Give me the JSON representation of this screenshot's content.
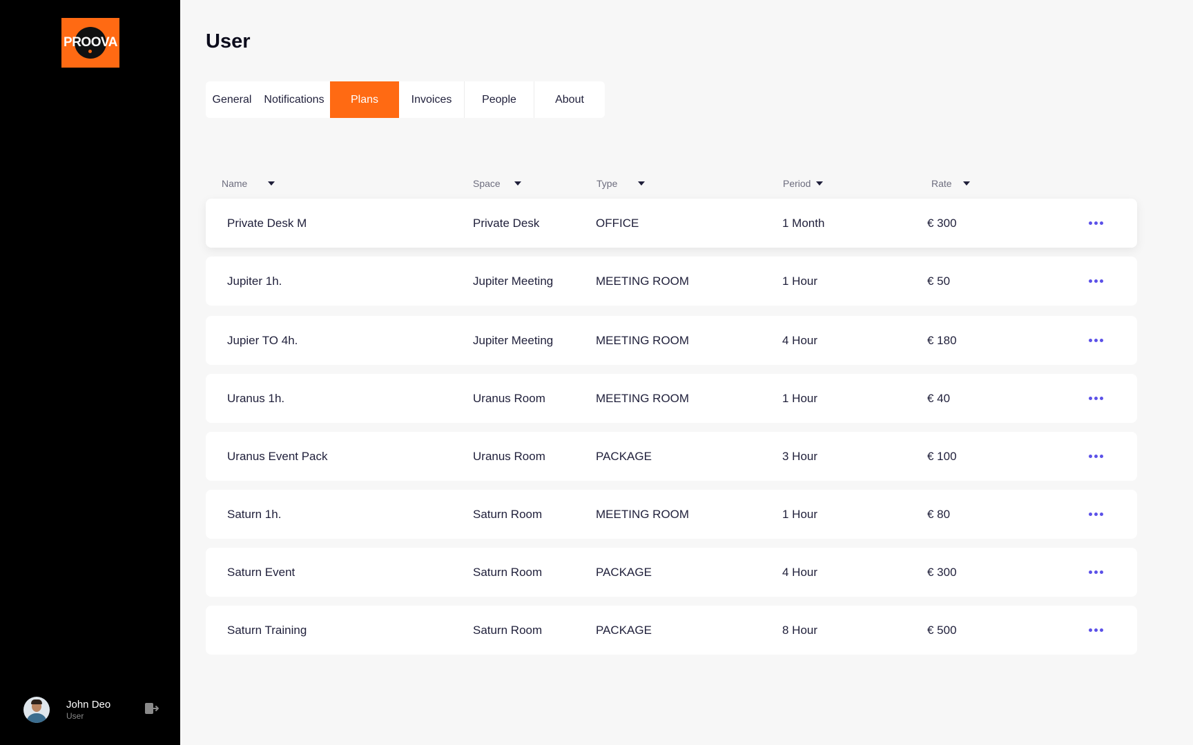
{
  "sidebar": {
    "logo_text": "PROOVA",
    "user": {
      "name": "John Deo",
      "role": "User"
    },
    "logout_icon": "logout-icon"
  },
  "page": {
    "title": "User"
  },
  "tabs": [
    {
      "label": "General",
      "active": false
    },
    {
      "label": "Notifications",
      "active": false
    },
    {
      "label": "Plans",
      "active": true
    },
    {
      "label": "Invoices",
      "active": false
    },
    {
      "label": "People",
      "active": false
    },
    {
      "label": "About",
      "active": false
    }
  ],
  "table": {
    "columns": [
      "Name",
      "Space",
      "Type",
      "Period",
      "Rate"
    ],
    "rows": [
      {
        "name": "Private Desk M",
        "space": "Private Desk",
        "type": "OFFICE",
        "period": "1 Month",
        "rate": "€ 300"
      },
      {
        "name": "Jupiter 1h.",
        "space": "Jupiter Meeting",
        "type": "MEETING ROOM",
        "period": "1 Hour",
        "rate": "€ 50"
      },
      {
        "name": "Jupier TO 4h.",
        "space": "Jupiter Meeting",
        "type": "MEETING ROOM",
        "period": "4 Hour",
        "rate": "€ 180"
      },
      {
        "name": "Uranus 1h.",
        "space": "Uranus Room",
        "type": "MEETING ROOM",
        "period": "1 Hour",
        "rate": "€ 40"
      },
      {
        "name": "Uranus Event Pack",
        "space": "Uranus Room",
        "type": "PACKAGE",
        "period": "3 Hour",
        "rate": "€ 100"
      },
      {
        "name": "Saturn 1h.",
        "space": "Saturn Room",
        "type": "MEETING ROOM",
        "period": "1 Hour",
        "rate": "€ 80"
      },
      {
        "name": "Saturn Event",
        "space": "Saturn Room",
        "type": "PACKAGE",
        "period": "4 Hour",
        "rate": "€ 300"
      },
      {
        "name": "Saturn Training",
        "space": "Saturn Room",
        "type": "PACKAGE",
        "period": "8 Hour",
        "rate": "€ 500"
      }
    ]
  },
  "colors": {
    "accent": "#ff6a13",
    "action_dots": "#5b51e8",
    "sidebar_bg": "#000000",
    "page_bg": "#f7f7f7"
  }
}
